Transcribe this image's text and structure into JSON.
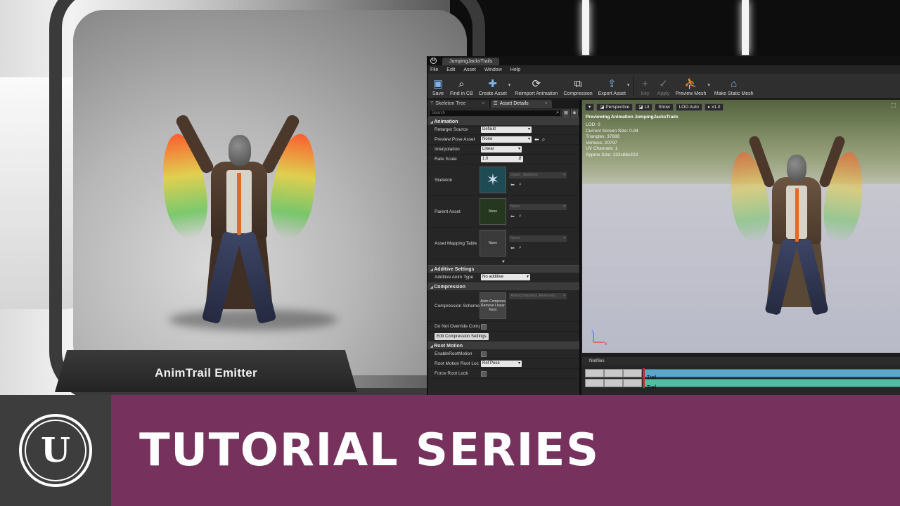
{
  "scene": {
    "emitter_label": "AnimTrail Emitter"
  },
  "editor": {
    "document_tab": "JumpingJacksTrails",
    "menu": [
      "File",
      "Edit",
      "Asset",
      "Window",
      "Help"
    ],
    "toolbar": {
      "save": "Save",
      "find_in_cb": "Find in CB",
      "create_asset": "Create Asset",
      "reimport": "Reimport Animation",
      "compression": "Compression",
      "export_asset": "Export Asset",
      "key": "Key",
      "apply": "Apply",
      "preview_mesh": "Preview Mesh",
      "make_static_mesh": "Make Static Mesh"
    },
    "panel_tabs": {
      "skeleton_tree": "Skeleton Tree",
      "asset_details": "Asset Details"
    },
    "search_placeholder": "Search",
    "details": {
      "animation": {
        "header": "Animation",
        "retarget_source_label": "Retarget Source",
        "retarget_source_value": "Default",
        "preview_pose_label": "Preview Pose Asset",
        "preview_pose_value": "None",
        "interpolation_label": "Interpolation",
        "interpolation_value": "Linear",
        "rate_scale_label": "Rate Scale",
        "rate_scale_value": "1.0",
        "skeleton_label": "Skeleton",
        "skeleton_value": "Owen_Skeleton",
        "parent_asset_label": "Parent Asset",
        "parent_asset_thumb": "None",
        "parent_asset_value": "None",
        "mapping_table_label": "Asset Mapping Table",
        "mapping_table_thumb": "None",
        "mapping_table_value": "None"
      },
      "additive": {
        "header": "Additive Settings",
        "type_label": "Additive Anim Type",
        "type_value": "No additive"
      },
      "compression": {
        "header": "Compression",
        "scheme_label": "Compression Scheme",
        "scheme_thumb": "Anim Compress Remove Linear Keys",
        "scheme_value": "AnimCompress_RemoveLi",
        "override_label": "Do Not Override Comp",
        "edit_button": "Edit Compression Settings"
      },
      "root_motion": {
        "header": "Root Motion",
        "enable_label": "EnableRootMotion",
        "lock_label": "Root Motion Root Loc",
        "lock_value": "Ref Pose",
        "force_label": "Force Root Lock"
      }
    },
    "viewport": {
      "perspective": "Perspective",
      "lit": "Lit",
      "show": "Show",
      "lod": "LOD Auto",
      "speed": "x1.0",
      "previewing": "Previewing Animation JumpingJacksTrails",
      "stats": [
        "LOD: 0",
        "Current Screen Size: 0.94",
        "Triangles: 37888",
        "Vertices: 20797",
        "UV Channels: 1",
        "Approx Size: 132x86x223"
      ]
    },
    "notifies": {
      "header": "Notifies",
      "track1": "Trail",
      "track2": "Trail"
    }
  },
  "banner": {
    "logo_letter": "U",
    "title": "TUTORIAL SERIES"
  }
}
